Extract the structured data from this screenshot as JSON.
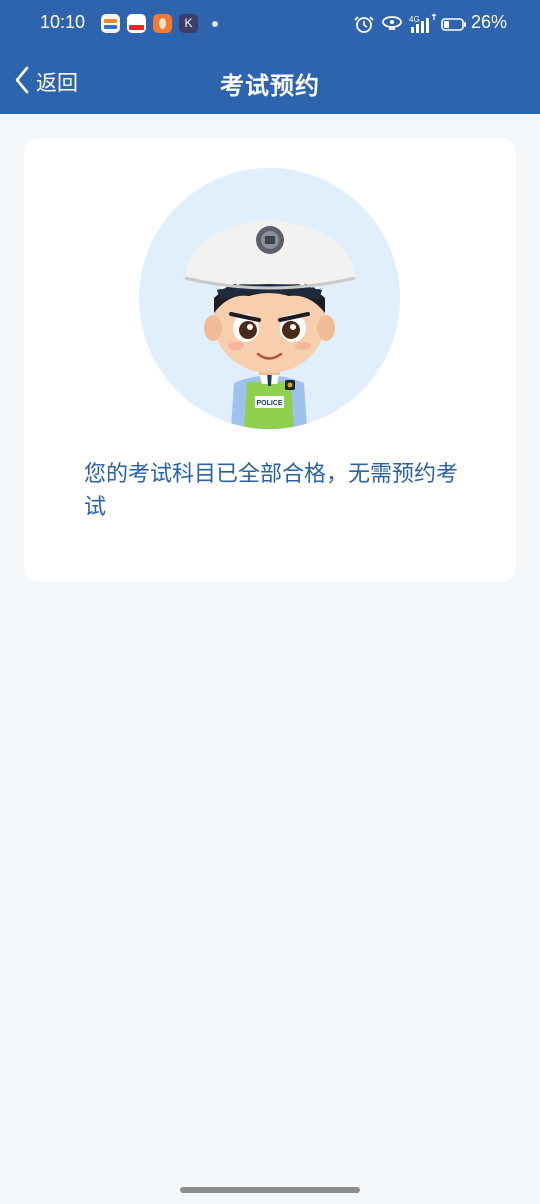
{
  "status_bar": {
    "time": "10:10",
    "app_k_letter": "K",
    "network_label": "4G",
    "battery_percent": "26%"
  },
  "navbar": {
    "back_label": "返回",
    "title": "考试预约"
  },
  "card": {
    "avatar_badge_text": "POLICE",
    "message": "您的考试科目已全部合格，无需预约考试"
  },
  "colors": {
    "header_bg": "#2e63ad",
    "page_bg": "#f3f7fa",
    "message_text": "#2a62a8",
    "avatar_circle": "#e1eefc"
  },
  "icons": [
    "back-chevron-icon",
    "alarm-icon",
    "hotspot-icon",
    "signal-icon",
    "battery-icon"
  ]
}
